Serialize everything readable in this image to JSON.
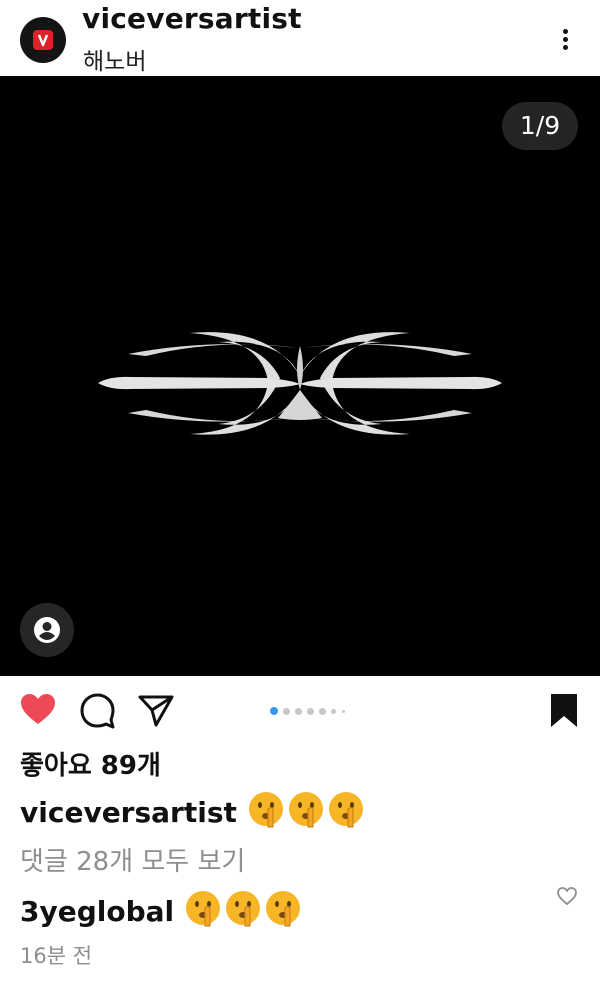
{
  "header": {
    "username": "viceversartist",
    "location": "해노버",
    "avatar_icon": "brand-logo-icon",
    "more_icon": "more-vertical-icon"
  },
  "media": {
    "page_counter": "1/9",
    "current_page": 1,
    "total_pages": 9,
    "tag_icon": "user-tag-icon"
  },
  "actions": {
    "like_icon": "heart-filled-icon",
    "comment_icon": "comment-icon",
    "share_icon": "send-icon",
    "save_icon": "bookmark-filled-icon",
    "liked": true,
    "saved": true
  },
  "post": {
    "likes_text": "좋아요 89개",
    "caption_user": "viceversartist",
    "caption_emoji_count": 3,
    "view_comments_text": "댓글 28개 모두 보기",
    "comment_user": "3yeglobal",
    "comment_emoji_count": 3,
    "timestamp": "16분 전"
  },
  "colors": {
    "like_red": "#ed4956",
    "active_dot": "#3897f0",
    "muted_text": "#8e8e8e",
    "brand_red": "#d8232a"
  }
}
